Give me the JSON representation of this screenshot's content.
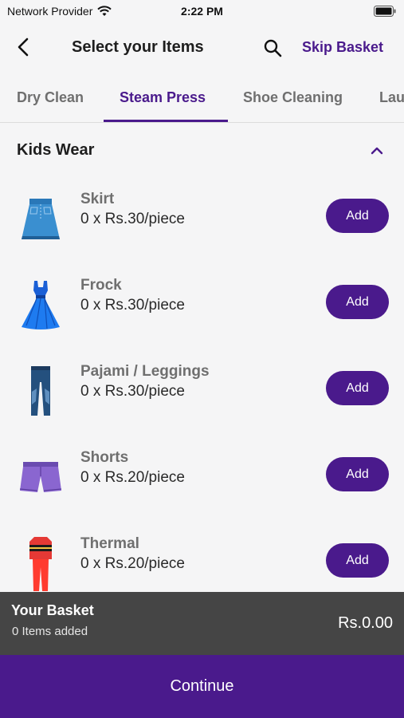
{
  "status_bar": {
    "carrier": "Network Provider",
    "time": "2:22 PM",
    "icons": [
      "wifi-icon",
      "battery-icon"
    ]
  },
  "header": {
    "back_icon": "chevron-left-icon",
    "title": "Select your Items",
    "search_icon": "search-icon",
    "skip_label": "Skip Basket"
  },
  "tabs": [
    {
      "label": "Dry Clean",
      "active": false
    },
    {
      "label": "Steam Press",
      "active": true
    },
    {
      "label": "Shoe Cleaning",
      "active": false
    },
    {
      "label": "Lau",
      "active": false
    }
  ],
  "section": {
    "label": "Kids Wear",
    "toggle_icon": "chevron-up-icon"
  },
  "items": [
    {
      "name": "Skirt",
      "price": "0 x Rs.30/piece",
      "add_label": "Add",
      "icon": "skirt-icon"
    },
    {
      "name": "Frock",
      "price": "0 x Rs.30/piece",
      "add_label": "Add",
      "icon": "frock-icon"
    },
    {
      "name": "Pajami / Leggings",
      "price": "0 x Rs.30/piece",
      "add_label": "Add",
      "icon": "leggings-icon"
    },
    {
      "name": "Shorts",
      "price": "0 x Rs.20/piece",
      "add_label": "Add",
      "icon": "shorts-icon"
    },
    {
      "name": "Thermal",
      "price": "0 x Rs.20/piece",
      "add_label": "Add",
      "icon": "thermal-icon"
    }
  ],
  "basket": {
    "title": "Your Basket",
    "count": "0 Items added",
    "total": "Rs.0.00"
  },
  "continue_label": "Continue",
  "colors": {
    "accent": "#4a1a8c",
    "basket_bg": "#454545",
    "background": "#f5f5f6"
  }
}
